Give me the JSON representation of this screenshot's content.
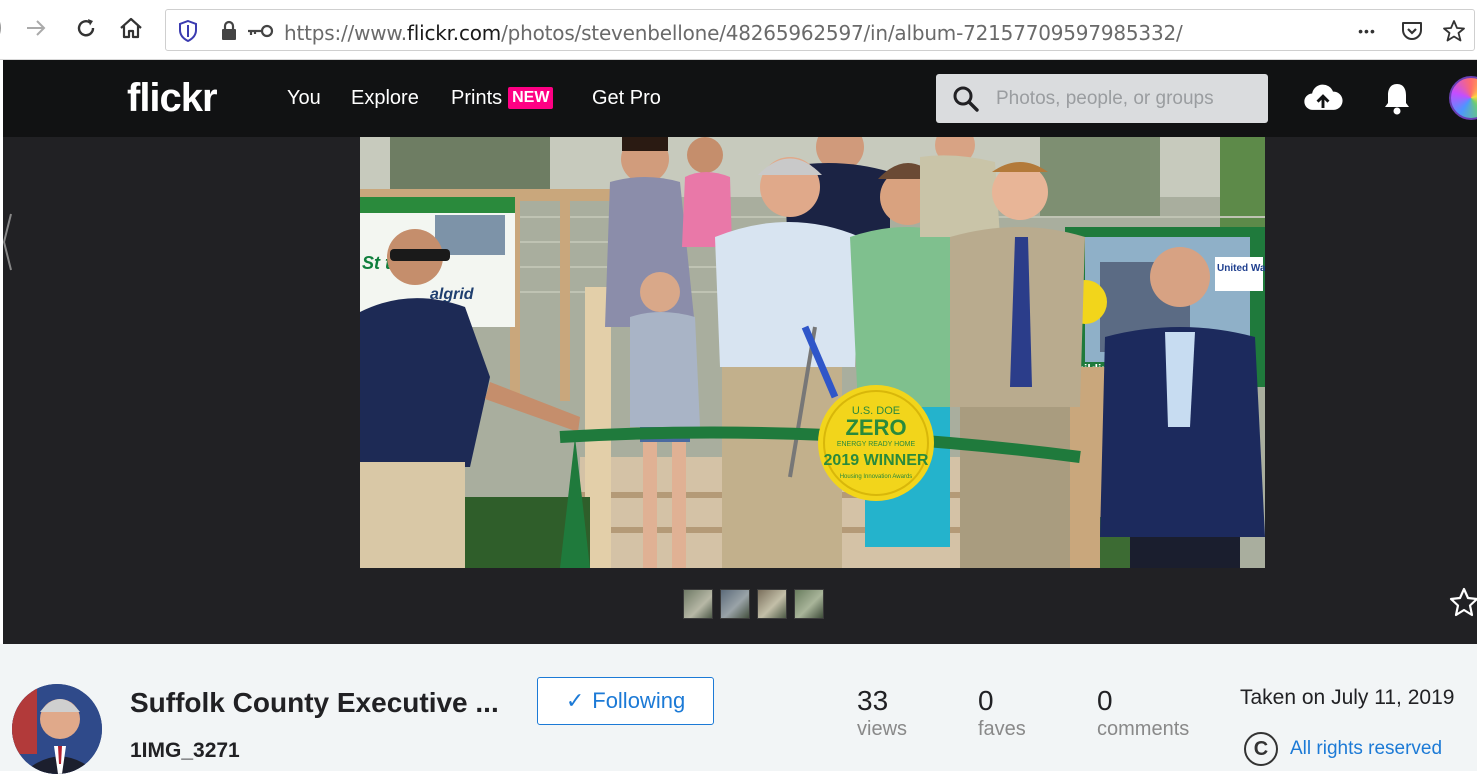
{
  "browser": {
    "url_prefix": "https://www.",
    "url_host": "flickr.com",
    "url_path": "/photos/stevenbellone/48265962597/in/album-72157709597985332/",
    "more_glyph": "•••"
  },
  "header": {
    "logo": "flickr",
    "nav": {
      "you": "You",
      "explore": "Explore",
      "prints": "Prints",
      "prints_badge": "NEW",
      "get_pro": "Get Pro"
    },
    "search_placeholder": "Photos, people, or groups"
  },
  "photo": {
    "badge_top": "U.S. DOE",
    "badge_main": "ZERO",
    "badge_sub": "ENERGY READY HOME",
    "badge_year": "2019 WINNER",
    "badge_bottom": "Housing Innovation Awards",
    "sign_left": "St   t",
    "sign_left_2": "algrid",
    "sign_right": "United Way",
    "sign_right_2": "Buildin"
  },
  "info": {
    "owner_name": "Suffolk County Executive ...",
    "photo_title": "1IMG_3271",
    "follow_label": "Following",
    "follow_check": "✓",
    "views_count": "33",
    "views_label": "views",
    "faves_count": "0",
    "faves_label": "faves",
    "comments_count": "0",
    "comments_label": "comments",
    "taken": "Taken on July 11, 2019",
    "rights_symbol": "C",
    "rights_label": "All rights reserved"
  },
  "colors": {
    "header_bg": "#111213",
    "stage_bg": "#212124",
    "accent_pink": "#ff0084",
    "link_blue": "#1c7ad6",
    "ribbon_green": "#1f7a3c",
    "badge_yellow": "#f2d51b"
  }
}
